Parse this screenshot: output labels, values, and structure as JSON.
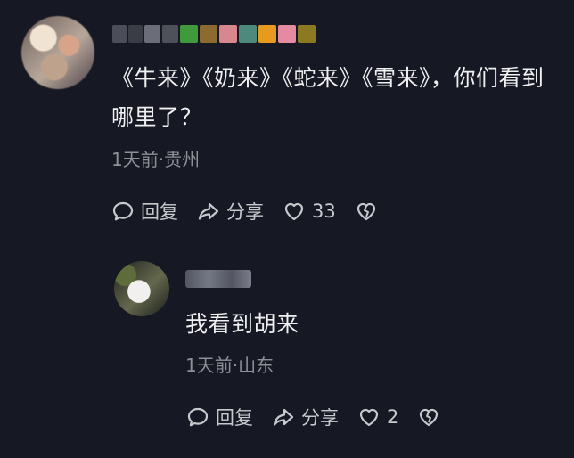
{
  "comment": {
    "text_line1": "《牛来》《奶来》《蛇来》《雪来》，你们看到",
    "text_line2": "哪里了？",
    "meta": "1天前·贵州",
    "actions": {
      "reply_label": "回复",
      "share_label": "分享",
      "like_count": "33"
    }
  },
  "reply": {
    "text": "我看到胡来",
    "meta": "1天前·山东",
    "actions": {
      "reply_label": "回复",
      "share_label": "分享",
      "like_count": "2"
    }
  },
  "colors": {
    "background": "#161823",
    "text": "#f0f0f1",
    "meta": "#8f9097",
    "action": "#c8c9cd"
  },
  "icons": {
    "reply": "reply-bubble-icon",
    "share": "share-arrow-icon",
    "like": "heart-icon",
    "dislike": "broken-heart-icon"
  }
}
